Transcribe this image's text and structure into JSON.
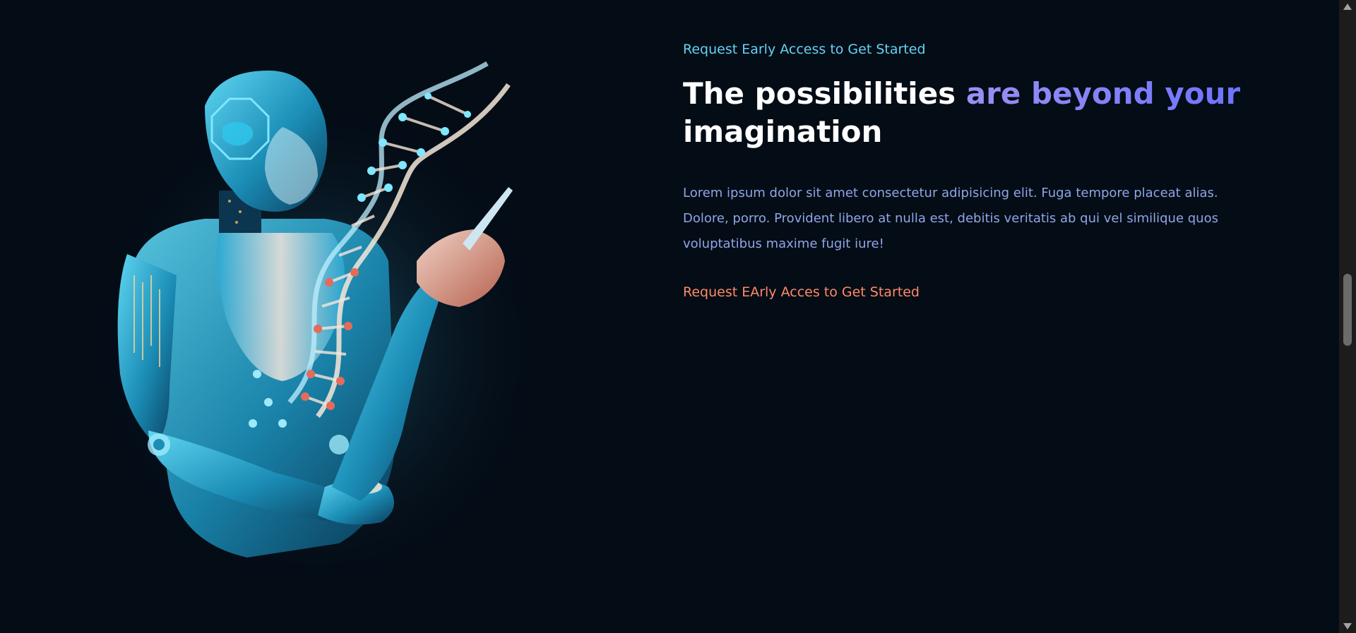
{
  "hero": {
    "eyebrow": "Request Early Access to Get Started",
    "headline_plain_1": "The possibilities ",
    "headline_accent": "are beyond your",
    "headline_plain_2": " imagination",
    "body": "Lorem ipsum dolor sit amet consectetur adipisicing elit. Fuga tempore placeat alias. Dolore, porro. Provident libero at nulla est, debitis veritatis ab qui vel similique quos voluptatibus maxime fugit iure!",
    "cta": "Request EArly Acces to Get Started",
    "image_subject": "robot-holding-dna-helix-illustration"
  },
  "colors": {
    "background": "#040c16",
    "eyebrow": "#62d3f4",
    "accent": "#8a84f3",
    "body": "#8fa6e6",
    "cta": "#ff8a68"
  },
  "scrollbar": {
    "up_icon": "scroll-up-arrow-icon",
    "down_icon": "scroll-down-arrow-icon"
  }
}
